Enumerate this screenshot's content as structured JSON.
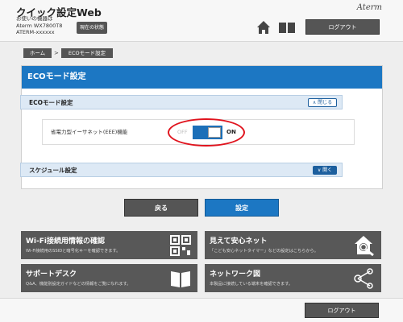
{
  "header": {
    "title": "クイック設定Web",
    "device_line1": "お使いの機器は",
    "device_line2": "Aterm WX7800T8",
    "device_line3": "ATERM-xxxxxx",
    "status_button": "現在の状態",
    "brand": "Aterm",
    "logout_label": "ログアウト"
  },
  "breadcrumb": {
    "home": "ホーム",
    "separator": ">",
    "current": "ECOモード設定"
  },
  "panel": {
    "title": "ECOモード設定",
    "eco_section": {
      "label": "ECOモード設定",
      "toggle_button": "閉じる"
    },
    "eee_setting": {
      "label": "省電力型イーサネット(EEE)機能",
      "off_label": "OFF",
      "on_label": "ON",
      "state": "ON"
    },
    "schedule_section": {
      "label": "スケジュール設定",
      "toggle_button": "開く"
    }
  },
  "actions": {
    "back": "戻る",
    "set": "設定"
  },
  "tiles": [
    {
      "title": "Wi-Fi接続用情報の確認",
      "desc": "Wi-Fi接続用のSSIDと暗号化キーを確認できます。",
      "icon": "qr-code-icon"
    },
    {
      "title": "見えて安心ネット",
      "desc": "「こども安心ネットタイマー」などの設定はこちらから。",
      "icon": "house-search-icon"
    },
    {
      "title": "サポートデスク",
      "desc": "Q&A、機能別設定ガイドなどの情報をご覧になれます。",
      "icon": "book-icon"
    },
    {
      "title": "ネットワーク図",
      "desc": "本製品に接続している端末を確認できます。",
      "icon": "network-icon"
    }
  ],
  "footer": {
    "logout_label": "ログアウト"
  },
  "colors": {
    "primary_blue": "#1c77c3",
    "dark_gray": "#555555",
    "highlight_red": "#e0141e",
    "section_bg": "#dde9f5"
  }
}
